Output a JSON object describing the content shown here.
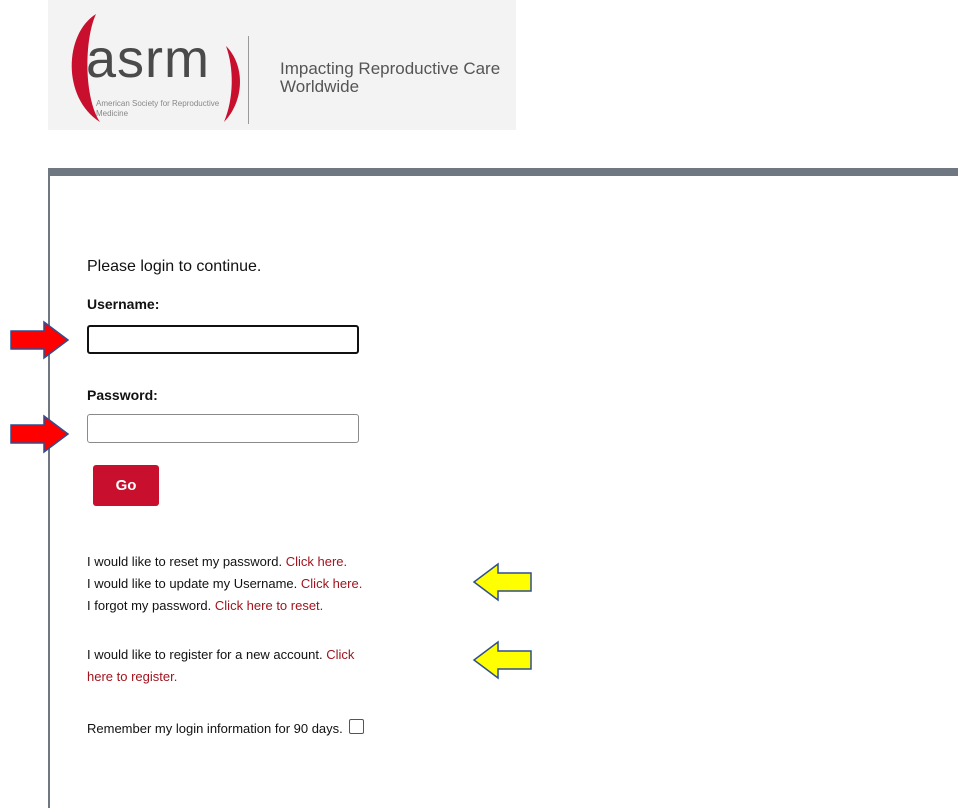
{
  "logo": {
    "wordmark": "asrm",
    "org_name": "American Society for Reproductive Medicine",
    "tagline": "Impacting Reproductive Care Worldwide",
    "accent_color": "#c8102e"
  },
  "login": {
    "prompt": "Please login to continue.",
    "username_label": "Username:",
    "username_value": "",
    "password_label": "Password:",
    "password_value": "",
    "submit_label": "Go"
  },
  "help_links": {
    "reset_text": "I would like to reset my password.",
    "reset_link": "Click here.",
    "update_text": "I would like to update my Username.",
    "update_link": "Click here.",
    "forgot_text": "I forgot my password.",
    "forgot_link": "Click here to reset.",
    "register_text": "I would like to register for a new account.",
    "register_link_1": "Click",
    "register_link_2": "here to register."
  },
  "remember": {
    "label": "Remember my login information for 90 days.",
    "checked": false
  },
  "annotations": {
    "red_arrow_color": "#ff0000",
    "yellow_arrow_color": "#ffff00",
    "arrow_outline_color": "#2f4f8f"
  }
}
